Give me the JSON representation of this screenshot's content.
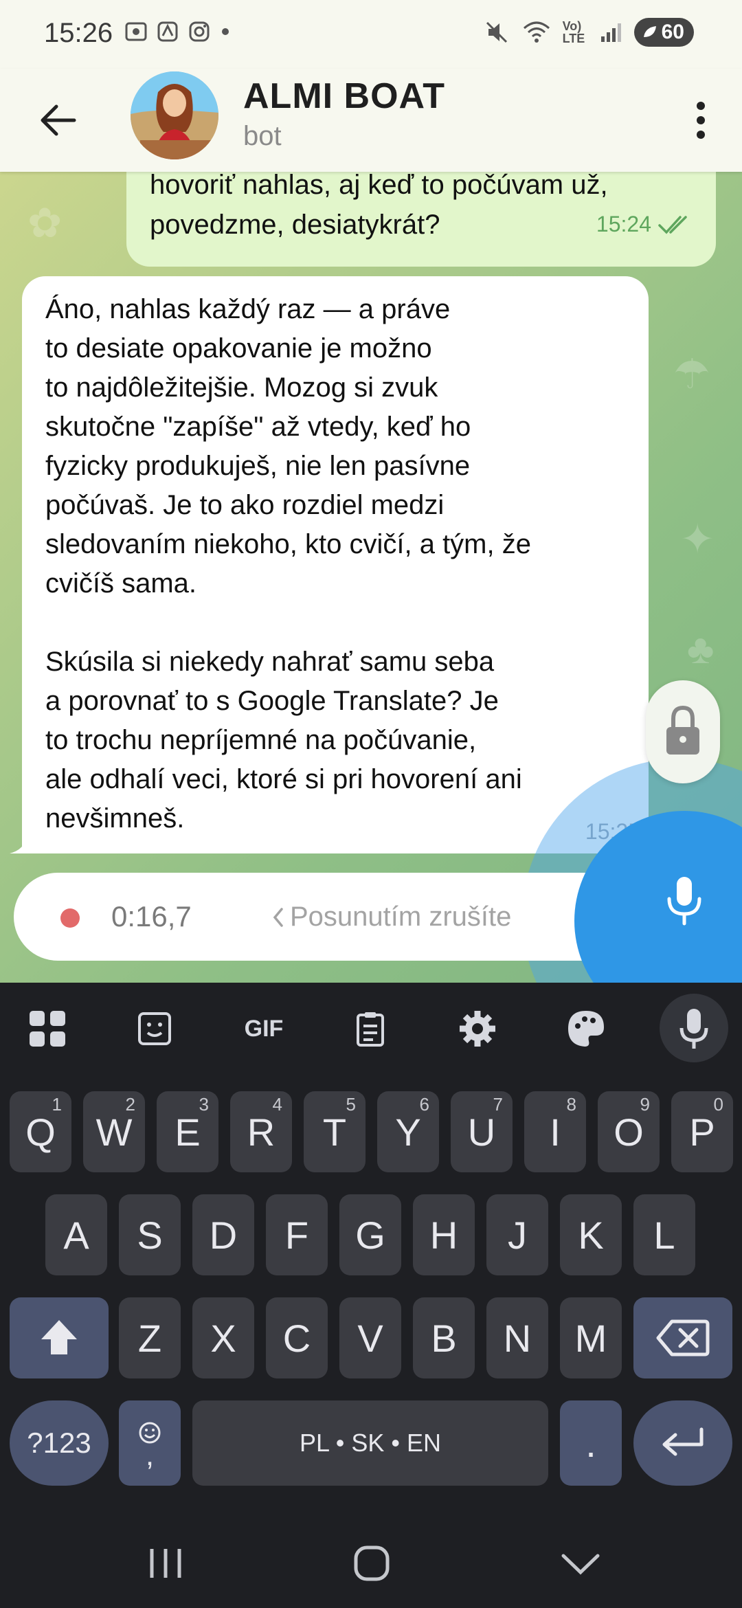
{
  "status_bar": {
    "time": "15:26",
    "battery": "60",
    "network_label": "Vo) LTE"
  },
  "header": {
    "title": "ALMI BOAT",
    "subtitle": "bot"
  },
  "messages": [
    {
      "direction": "outgoing",
      "text": "hovoriť nahlas, aj keď to počúvam už,\npovedzme, desiatykrát?",
      "time": "15:24",
      "status": "read"
    },
    {
      "direction": "incoming",
      "text": "Áno, nahlas každý raz — a práve\nto desiate opakovanie je možno\nto najdôležitejšie. Mozog si zvuk\nskutočne \"zapíše\" až vtedy, keď ho\nfyzicky produkuješ, nie len pasívne\npočúvaš. Je to ako rozdiel medzi\nsledovaním niekoho, kto cvičí, a tým, že\ncvičíš sama.\n\nSkúsila si niekedy nahrať samu seba\na porovnať to s Google Translate? Je\nto trochu nepríjemné na počúvanie,\nale odhalí veci, ktoré si pri hovorení ani\nnevšimneš.",
      "time": "15:25"
    }
  ],
  "recording": {
    "duration": "0:16,7",
    "slide_hint": "Posunutím zrušíte"
  },
  "keyboard": {
    "toolbar": {
      "gif_label": "GIF"
    },
    "row1": [
      {
        "key": "Q",
        "hint": "1"
      },
      {
        "key": "W",
        "hint": "2"
      },
      {
        "key": "E",
        "hint": "3"
      },
      {
        "key": "R",
        "hint": "4"
      },
      {
        "key": "T",
        "hint": "5"
      },
      {
        "key": "Y",
        "hint": "6"
      },
      {
        "key": "U",
        "hint": "7"
      },
      {
        "key": "I",
        "hint": "8"
      },
      {
        "key": "O",
        "hint": "9"
      },
      {
        "key": "P",
        "hint": "0"
      }
    ],
    "row2": [
      "A",
      "S",
      "D",
      "F",
      "G",
      "H",
      "J",
      "K",
      "L"
    ],
    "row3": [
      "Z",
      "X",
      "C",
      "V",
      "B",
      "N",
      "M"
    ],
    "symbols_label": "?123",
    "comma_label": ",",
    "space_label": "PL • SK • EN",
    "period_label": "."
  },
  "colors": {
    "accent_blue": "#2f97e6",
    "outgoing_bubble": "#e2f6cb",
    "read_check": "#5ea65d",
    "record_dot": "#e26a6a"
  }
}
